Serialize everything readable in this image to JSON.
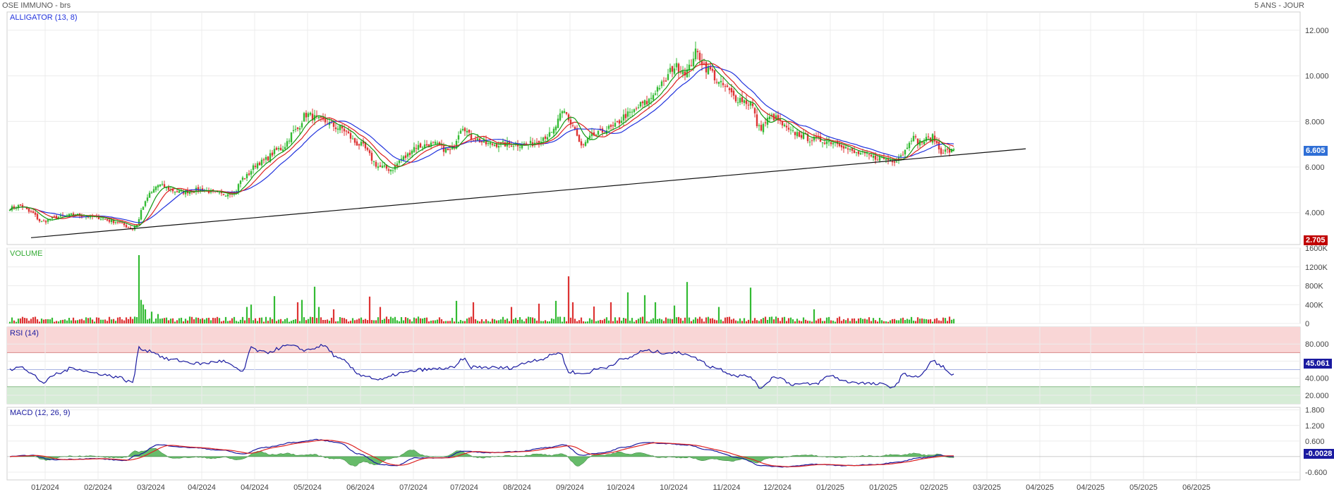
{
  "header": {
    "instrument": "OSE IMMUNO - brs",
    "period": "5 ANS - JOUR"
  },
  "colors": {
    "up": "#33bb33",
    "down": "#dd3333",
    "jaw": "#2233dd",
    "teeth": "#dd2222",
    "lips": "#119911",
    "rsi": "#1a1aa0",
    "macd": "#1a1aa0",
    "signal": "#dd2222",
    "hist": "#4caf50",
    "volLabel": "#33aa33"
  },
  "chart_data": [
    {
      "type": "candlestick",
      "name": "price",
      "label": "ALLIGATOR (13, 8)",
      "ylim": [
        2.6,
        12.8
      ],
      "yticks": [
        "12.000",
        "10.000",
        "8.000",
        "6.000",
        "4.000"
      ],
      "ytick_values": [
        12,
        10,
        8,
        6,
        4
      ],
      "last_value": "6.605",
      "min_value": "2.705",
      "anchors": [
        [
          0,
          4.2
        ],
        [
          5,
          4.3
        ],
        [
          10,
          4.0
        ],
        [
          15,
          3.6
        ],
        [
          22,
          3.8
        ],
        [
          30,
          3.9
        ],
        [
          40,
          3.8
        ],
        [
          50,
          3.6
        ],
        [
          58,
          3.3
        ],
        [
          60,
          3.5
        ],
        [
          63,
          4.3
        ],
        [
          66,
          4.8
        ],
        [
          70,
          5.2
        ],
        [
          80,
          4.9
        ],
        [
          90,
          5.0
        ],
        [
          100,
          4.8
        ],
        [
          106,
          4.9
        ],
        [
          110,
          5.5
        ],
        [
          118,
          6.2
        ],
        [
          128,
          6.8
        ],
        [
          135,
          7.6
        ],
        [
          140,
          8.3
        ],
        [
          148,
          8.0
        ],
        [
          156,
          7.7
        ],
        [
          165,
          7.0
        ],
        [
          175,
          6.0
        ],
        [
          180,
          5.9
        ],
        [
          186,
          6.4
        ],
        [
          192,
          6.9
        ],
        [
          200,
          7.0
        ],
        [
          208,
          6.7
        ],
        [
          214,
          7.8
        ],
        [
          218,
          7.3
        ],
        [
          226,
          7.0
        ],
        [
          235,
          7.0
        ],
        [
          245,
          7.0
        ],
        [
          255,
          7.4
        ],
        [
          262,
          8.4
        ],
        [
          266,
          7.8
        ],
        [
          270,
          6.9
        ],
        [
          276,
          7.4
        ],
        [
          284,
          7.7
        ],
        [
          292,
          8.3
        ],
        [
          300,
          8.8
        ],
        [
          308,
          9.6
        ],
        [
          314,
          10.4
        ],
        [
          320,
          10.2
        ],
        [
          324,
          11.0
        ],
        [
          330,
          10.3
        ],
        [
          336,
          9.6
        ],
        [
          344,
          9.0
        ],
        [
          350,
          8.8
        ],
        [
          354,
          7.7
        ],
        [
          360,
          8.2
        ],
        [
          370,
          7.5
        ],
        [
          380,
          7.2
        ],
        [
          390,
          7.1
        ],
        [
          400,
          6.6
        ],
        [
          410,
          6.4
        ],
        [
          418,
          6.3
        ],
        [
          422,
          6.6
        ],
        [
          426,
          7.3
        ],
        [
          430,
          7.1
        ],
        [
          436,
          7.3
        ],
        [
          440,
          6.7
        ]
      ],
      "alligator": {
        "jaw_period": 13,
        "lips_period": 8
      },
      "trendline": [
        [
          10,
          2.9
        ],
        [
          480,
          6.8
        ]
      ],
      "x_dates": [
        "01/2024",
        "02/2024",
        "03/2024",
        "04/2024",
        "04/2024",
        "05/2024",
        "06/2024",
        "07/2024",
        "07/2024",
        "08/2024",
        "09/2024",
        "10/2024",
        "10/2024",
        "11/2024",
        "12/2024",
        "01/2025",
        "01/2025",
        "02/2025",
        "03/2025",
        "04/2025",
        "04/2025",
        "05/2025",
        "06/2025"
      ],
      "x_date_index": [
        20,
        45,
        70,
        94,
        119,
        144,
        169,
        194,
        218,
        243,
        268,
        292,
        317,
        342,
        366,
        391,
        416,
        440,
        465,
        490,
        514,
        539,
        564
      ]
    },
    {
      "type": "bar",
      "name": "volume",
      "label": "VOLUME",
      "ylim": [
        0,
        1600000
      ],
      "yticks": [
        "1600K",
        "1200K",
        "800K",
        "400K",
        "0"
      ],
      "ytick_values": [
        1600000,
        1200000,
        800000,
        400000,
        0
      ],
      "base": 70000,
      "spikes": [
        [
          61,
          1450000
        ],
        [
          62,
          500000
        ],
        [
          63,
          400000
        ],
        [
          64,
          300000
        ],
        [
          67,
          250000
        ],
        [
          70,
          200000
        ],
        [
          112,
          350000
        ],
        [
          114,
          400000
        ],
        [
          125,
          580000
        ],
        [
          136,
          450000
        ],
        [
          138,
          500000
        ],
        [
          144,
          780000
        ],
        [
          146,
          350000
        ],
        [
          153,
          300000
        ],
        [
          170,
          570000
        ],
        [
          175,
          350000
        ],
        [
          211,
          480000
        ],
        [
          219,
          450000
        ],
        [
          237,
          350000
        ],
        [
          250,
          420000
        ],
        [
          258,
          480000
        ],
        [
          264,
          1000000
        ],
        [
          266,
          450000
        ],
        [
          276,
          360000
        ],
        [
          284,
          450000
        ],
        [
          292,
          660000
        ],
        [
          300,
          600000
        ],
        [
          305,
          450000
        ],
        [
          314,
          380000
        ],
        [
          320,
          880000
        ],
        [
          335,
          350000
        ],
        [
          350,
          760000
        ],
        [
          380,
          300000
        ]
      ]
    },
    {
      "type": "line",
      "name": "rsi",
      "label": "RSI (14)",
      "ylim": [
        10,
        100
      ],
      "yticks": [
        "80.000",
        "60.000",
        "40.000",
        "20.000"
      ],
      "ytick_values": [
        80,
        60,
        40,
        20
      ],
      "overbought": 70,
      "oversold": 30,
      "midline": 50,
      "last_value": "45.061",
      "anchors": [
        [
          0,
          50
        ],
        [
          5,
          55
        ],
        [
          10,
          45
        ],
        [
          16,
          35
        ],
        [
          22,
          45
        ],
        [
          30,
          52
        ],
        [
          40,
          46
        ],
        [
          50,
          42
        ],
        [
          58,
          35
        ],
        [
          61,
          75
        ],
        [
          66,
          72
        ],
        [
          75,
          62
        ],
        [
          90,
          57
        ],
        [
          100,
          60
        ],
        [
          110,
          48
        ],
        [
          114,
          75
        ],
        [
          120,
          70
        ],
        [
          132,
          78
        ],
        [
          140,
          73
        ],
        [
          148,
          78
        ],
        [
          156,
          62
        ],
        [
          166,
          44
        ],
        [
          175,
          38
        ],
        [
          185,
          46
        ],
        [
          195,
          50
        ],
        [
          210,
          52
        ],
        [
          214,
          63
        ],
        [
          218,
          53
        ],
        [
          235,
          52
        ],
        [
          250,
          62
        ],
        [
          260,
          70
        ],
        [
          264,
          48
        ],
        [
          270,
          45
        ],
        [
          280,
          52
        ],
        [
          290,
          62
        ],
        [
          300,
          72
        ],
        [
          310,
          70
        ],
        [
          320,
          69
        ],
        [
          324,
          63
        ],
        [
          332,
          53
        ],
        [
          344,
          43
        ],
        [
          350,
          42
        ],
        [
          354,
          29
        ],
        [
          362,
          42
        ],
        [
          370,
          33
        ],
        [
          380,
          33
        ],
        [
          388,
          43
        ],
        [
          395,
          36
        ],
        [
          410,
          33
        ],
        [
          418,
          30
        ],
        [
          422,
          44
        ],
        [
          430,
          42
        ],
        [
          436,
          60
        ],
        [
          440,
          55
        ],
        [
          444,
          45
        ],
        [
          446,
          45
        ]
      ]
    },
    {
      "type": "line",
      "name": "macd",
      "label": "MACD (12, 26, 9)",
      "ylim": [
        -0.9,
        1.9
      ],
      "yticks": [
        "1.800",
        "1.200",
        "0.600",
        "-0.600"
      ],
      "ytick_values": [
        1.8,
        1.2,
        0.6,
        -0.6
      ],
      "zero_tick_position": "below 0.600",
      "last_value": "-0.0028",
      "anchors": [
        [
          0,
          0
        ],
        [
          10,
          0.05
        ],
        [
          20,
          -0.12
        ],
        [
          40,
          -0.08
        ],
        [
          55,
          -0.15
        ],
        [
          60,
          0.05
        ],
        [
          70,
          0.45
        ],
        [
          85,
          0.35
        ],
        [
          100,
          0.25
        ],
        [
          110,
          0.1
        ],
        [
          120,
          0.35
        ],
        [
          135,
          0.55
        ],
        [
          145,
          0.65
        ],
        [
          155,
          0.55
        ],
        [
          165,
          0.1
        ],
        [
          175,
          -0.3
        ],
        [
          182,
          -0.35
        ],
        [
          192,
          -0.05
        ],
        [
          205,
          -0.05
        ],
        [
          214,
          0.2
        ],
        [
          226,
          0.15
        ],
        [
          240,
          0.2
        ],
        [
          255,
          0.35
        ],
        [
          262,
          0.45
        ],
        [
          270,
          0.05
        ],
        [
          280,
          0.15
        ],
        [
          290,
          0.35
        ],
        [
          300,
          0.55
        ],
        [
          310,
          0.5
        ],
        [
          320,
          0.45
        ],
        [
          330,
          0.25
        ],
        [
          345,
          -0.05
        ],
        [
          355,
          -0.35
        ],
        [
          365,
          -0.4
        ],
        [
          380,
          -0.3
        ],
        [
          395,
          -0.35
        ],
        [
          410,
          -0.3
        ],
        [
          420,
          -0.2
        ],
        [
          430,
          -0.05
        ],
        [
          440,
          0.05
        ],
        [
          446,
          0
        ]
      ]
    }
  ]
}
